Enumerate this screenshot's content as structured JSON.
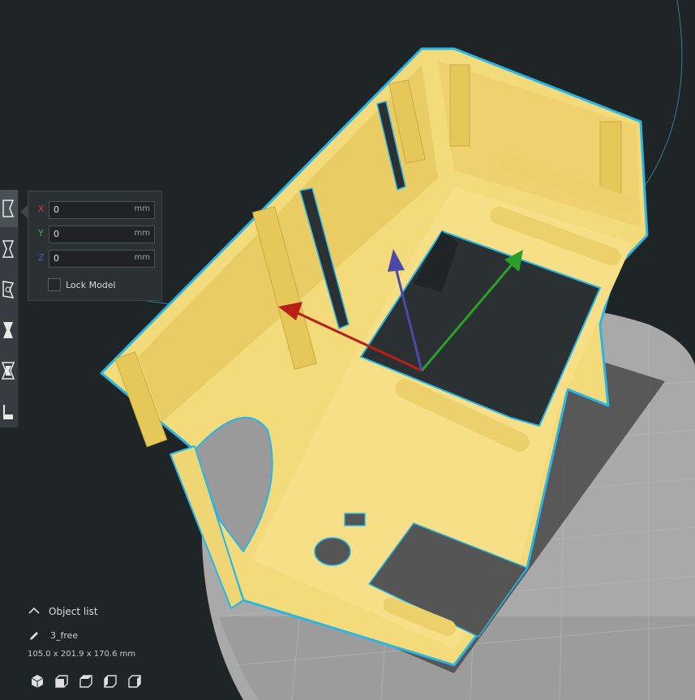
{
  "toolbar": {
    "tools": [
      {
        "name": "move-tool",
        "active": true
      },
      {
        "name": "scale-tool",
        "active": false
      },
      {
        "name": "rotate-tool",
        "active": false
      },
      {
        "name": "mirror-tool",
        "active": false
      },
      {
        "name": "per-model-settings-tool",
        "active": false
      },
      {
        "name": "support-blocker-tool",
        "active": false
      }
    ]
  },
  "move_panel": {
    "x": {
      "label": "X",
      "value": "0",
      "unit": "mm",
      "color": "#d9342b"
    },
    "y": {
      "label": "Y",
      "value": "0",
      "unit": "mm",
      "color": "#3fb23f"
    },
    "z": {
      "label": "Z",
      "value": "0",
      "unit": "mm",
      "color": "#4a5ad9"
    },
    "lock_label": "Lock Model",
    "lock_checked": false
  },
  "object_list": {
    "header": "Object list",
    "filename": "3_free",
    "dimensions": "105.0 x 201.9 x 170.6 mm"
  },
  "view_buttons": [
    "3d-view-icon",
    "front-view-icon",
    "top-view-icon",
    "left-view-icon",
    "right-view-icon"
  ],
  "colors": {
    "background": "#1f2427",
    "model": "#f3da7a",
    "model_outline": "#29b6e6",
    "build_plate": "#a7a7a7",
    "axis_x": "#b81f17",
    "axis_y": "#2aa02a",
    "axis_z": "#4b4aa8"
  }
}
